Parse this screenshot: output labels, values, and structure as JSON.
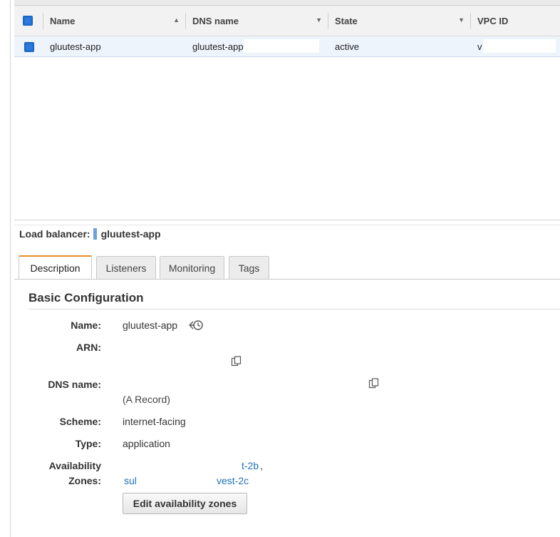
{
  "grid": {
    "columns": [
      {
        "label": "Name",
        "sort": "▲"
      },
      {
        "label": "DNS name",
        "sort": "▼"
      },
      {
        "label": "State",
        "sort": "▼"
      },
      {
        "label": "VPC ID"
      }
    ],
    "row": {
      "name": "gluutest-app",
      "dns_name": "gluutest-app",
      "state": "active",
      "vpc_id": "v"
    }
  },
  "lb": {
    "label": "Load balancer:",
    "name": "gluutest-app"
  },
  "tabs": [
    "Description",
    "Listeners",
    "Monitoring",
    "Tags"
  ],
  "section": {
    "title": "Basic Configuration"
  },
  "fields": {
    "name_label": "Name:",
    "name_value": "gluutest-app",
    "arn_label": "ARN:",
    "dns_label": "DNS name:",
    "dns_note": "(A Record)",
    "scheme_label": "Scheme:",
    "scheme_value": "internet-facing",
    "type_label": "Type:",
    "type_value": "application",
    "az_label_1": "Availability",
    "az_label_2": "Zones:",
    "az_line1": "t-2b",
    "az_line1_sep": ",",
    "az_line2_a": "sul",
    "az_line2_b": "vest-2c"
  },
  "buttons": {
    "edit_az": "Edit availability zones"
  },
  "colors": {
    "accent_tab": "#e88f2c",
    "link": "#1f6fb8",
    "checkbox": "#1f6fd1",
    "selected_row": "#eef4fc"
  }
}
